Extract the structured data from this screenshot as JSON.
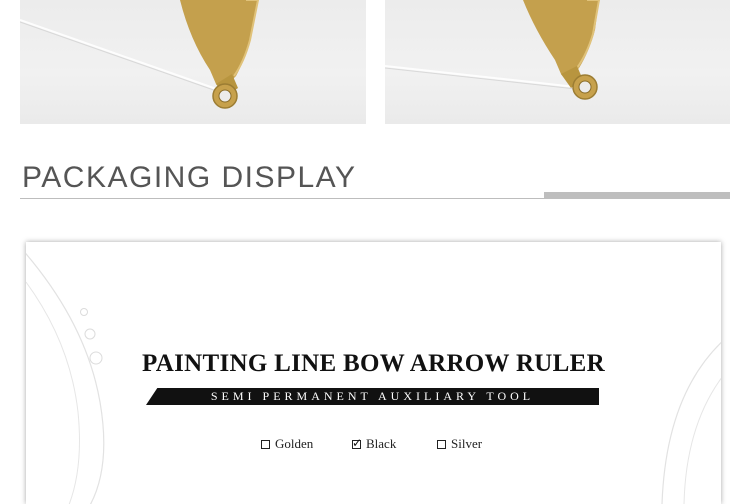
{
  "photos": [
    {
      "name": "gold-ruler-photo-left"
    },
    {
      "name": "gold-ruler-photo-right"
    }
  ],
  "section": {
    "title": "PACKAGING DISPLAY"
  },
  "package": {
    "title": "PAINTING LINE BOW ARROW RULER",
    "subtitle": "SEMI PERMANENT AUXILIARY TOOL",
    "options": [
      {
        "label": "Golden",
        "checked": false
      },
      {
        "label": "Black",
        "checked": true
      },
      {
        "label": "Silver",
        "checked": false
      }
    ]
  },
  "colors": {
    "accent_gold": "#c8a24e",
    "title_gray": "#555555",
    "divider_gray": "#bebebe"
  }
}
